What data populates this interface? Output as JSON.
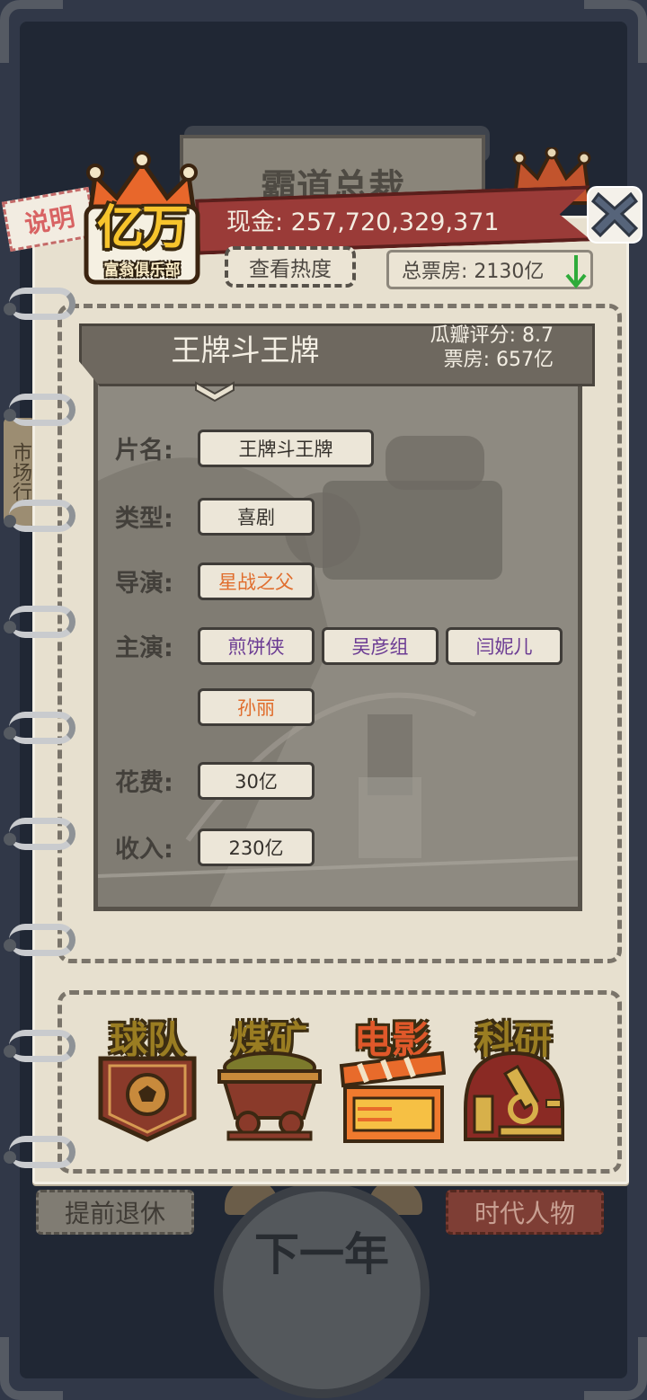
{
  "header": {
    "help_label": "说明",
    "logo_main": "亿万",
    "logo_sub": "富翁俱乐部",
    "cash_text": "现金: 257,720,329,371",
    "heat_button": "查看热度",
    "total_box_office": "总票房: 2130亿"
  },
  "background": {
    "title": "霸道总裁",
    "side_tab": "市场行",
    "retire_button": "提前退休",
    "era_button": "时代人物",
    "next_year_button": "下一年"
  },
  "movie": {
    "title": "王牌斗王牌",
    "rating": "瓜瓣评分: 8.7",
    "box_office": "票房: 657亿",
    "fields": {
      "name_label": "片名:",
      "name_value": "王牌斗王牌",
      "genre_label": "类型:",
      "genre_value": "喜剧",
      "director_label": "导演:",
      "director_value": "星战之父",
      "cast_label": "主演:",
      "cast": [
        "煎饼侠",
        "吴彦组",
        "闫妮儿",
        "孙丽"
      ],
      "cost_label": "花费:",
      "cost_value": "30亿",
      "income_label": "收入:",
      "income_value": "230亿"
    }
  },
  "industries": [
    {
      "label": "球队",
      "icon": "football-team-icon"
    },
    {
      "label": "煤矿",
      "icon": "coal-mine-cart-icon"
    },
    {
      "label": "电影",
      "icon": "film-clapper-icon"
    },
    {
      "label": "科研",
      "icon": "microscope-icon"
    }
  ],
  "colors": {
    "director_highlight": "#e06d2d",
    "cast_purple": "#6b3b93",
    "ribbon": "#9a3b38",
    "logo_gold": "#f7c42c"
  }
}
